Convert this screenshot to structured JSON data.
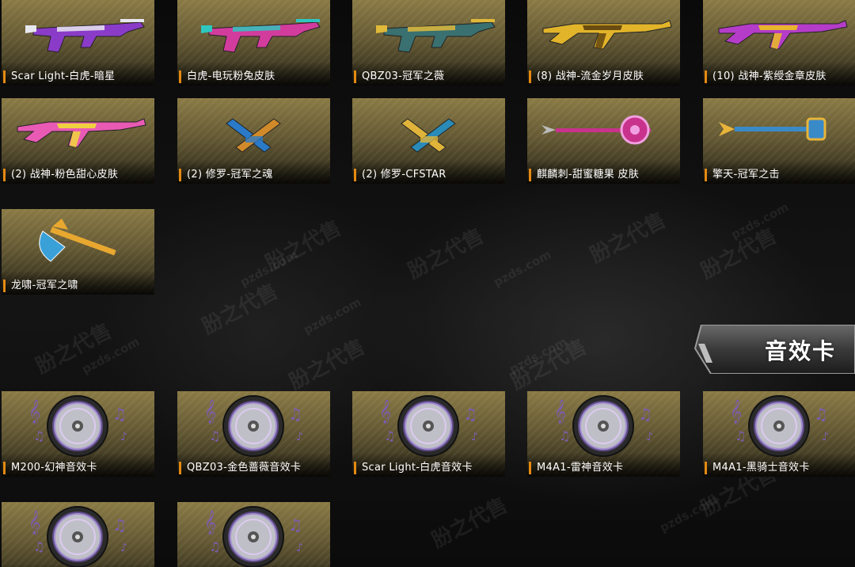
{
  "watermark": {
    "cn": "朌之代售",
    "domain": "pzds.com"
  },
  "section": {
    "title": "音效卡"
  },
  "weapons": [
    {
      "label": "Scar Light-白虎-暗星",
      "icon": "rifle-purple-white-icon",
      "kind": "rifle",
      "colors": [
        "#8a3cc8",
        "#e8e8f0"
      ]
    },
    {
      "label": "白虎-电玩粉兔皮肤",
      "icon": "rifle-pink-teal-icon",
      "kind": "rifle",
      "colors": [
        "#d23c9c",
        "#2fc6c0"
      ]
    },
    {
      "label": "QBZ03-冠军之薇",
      "icon": "rifle-gold-teal-icon",
      "kind": "rifle",
      "colors": [
        "#3a7070",
        "#e0b83a"
      ]
    },
    {
      "label": "(8) 战神-流金岁月皮肤",
      "icon": "ak-gold-icon",
      "kind": "ak",
      "colors": [
        "#e2b42a",
        "#6a4c10"
      ]
    },
    {
      "label": "(10) 战神-紫绶金章皮肤",
      "icon": "ak-purple-gold-icon",
      "kind": "ak",
      "colors": [
        "#b43cc8",
        "#e8b62c"
      ]
    },
    {
      "label": "(2) 战神-粉色甜心皮肤",
      "icon": "ak-pink-icon",
      "kind": "ak",
      "colors": [
        "#e85ab4",
        "#f0d040"
      ]
    },
    {
      "label": "(2) 修罗-冠军之魂",
      "icon": "dual-pistol-blue-icon",
      "kind": "pistols",
      "colors": [
        "#2a7ac8",
        "#d08a2a"
      ]
    },
    {
      "label": "(2) 修罗-CFSTAR",
      "icon": "dual-pistol-gold-icon",
      "kind": "pistols",
      "colors": [
        "#e0b43a",
        "#2a8ab8"
      ]
    },
    {
      "label": "麒麟刺-甜蜜糖果 皮肤",
      "icon": "spear-pink-icon",
      "kind": "spear",
      "colors": [
        "#c8328c",
        "#f0a0e0"
      ]
    },
    {
      "label": "擎天-冠军之击",
      "icon": "hammer-blue-gold-icon",
      "kind": "hammer",
      "colors": [
        "#3a8ac8",
        "#e8b43a"
      ]
    },
    {
      "label": "龙啸-冠军之啸",
      "icon": "axe-blue-gold-icon",
      "kind": "axe",
      "colors": [
        "#3aa0d8",
        "#e8a830"
      ]
    }
  ],
  "sound_cards": [
    {
      "label": "M200-幻神音效卡",
      "icon": "music-disc-icon"
    },
    {
      "label": "QBZ03-金色蔷薇音效卡",
      "icon": "music-disc-icon"
    },
    {
      "label": "Scar Light-白虎音效卡",
      "icon": "music-disc-icon"
    },
    {
      "label": "M4A1-雷神音效卡",
      "icon": "music-disc-icon"
    },
    {
      "label": "M4A1-黑骑士音效卡",
      "icon": "music-disc-icon"
    },
    {
      "label": "",
      "icon": "music-disc-icon"
    },
    {
      "label": "",
      "icon": "music-disc-icon"
    }
  ],
  "colors": {
    "accent": "#e58a12",
    "card_gold": "#8a7a45",
    "background": "#0b0b0b"
  }
}
